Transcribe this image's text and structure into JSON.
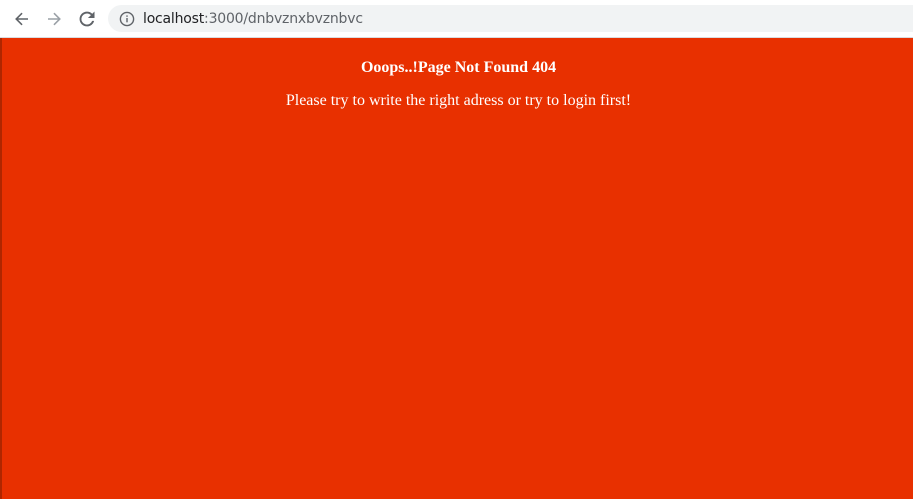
{
  "browser": {
    "url_host": "localhost",
    "url_path": ":3000/dnbvznxbvznbvc"
  },
  "page": {
    "title": "Ooops..!Page Not Found 404",
    "message": "Please try to write the right adress or try to login first!",
    "background_color": "#e83000",
    "text_color": "#ffffff"
  }
}
